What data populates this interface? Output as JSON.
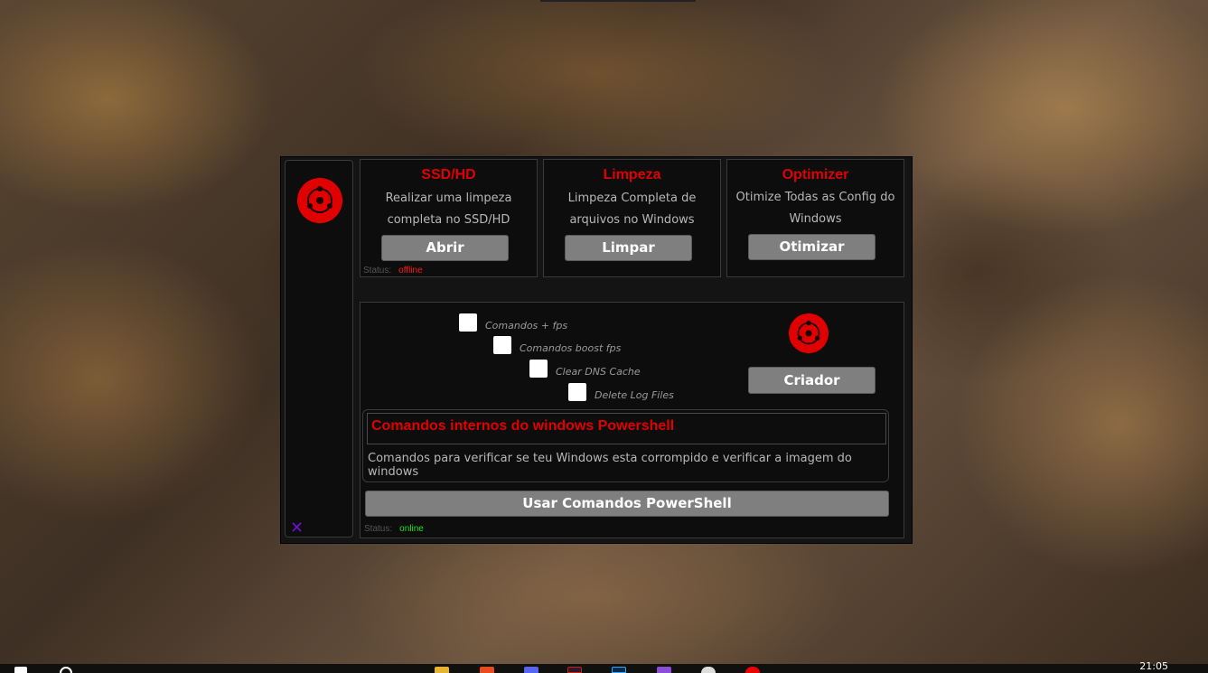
{
  "app": {
    "cards": [
      {
        "title": "SSD/HD",
        "description": "Realizar uma limpeza completa no SSD/HD",
        "button": "Abrir"
      },
      {
        "title": "Limpeza",
        "description": "Limpeza Completa de arquivos no Windows",
        "button": "Limpar"
      },
      {
        "title": "Optimizer",
        "description": "Otimize Todas as Config do Windows",
        "button": "Otimizar"
      }
    ],
    "status_top": {
      "label": "Status:",
      "value": "offline",
      "value_color": "#ff1a1a"
    },
    "options": [
      {
        "label": "Comandos + fps",
        "checked": false
      },
      {
        "label": "Comandos boost fps",
        "checked": false
      },
      {
        "label": "Clear DNS Cache",
        "checked": false
      },
      {
        "label": "Delete Log Files",
        "checked": false
      }
    ],
    "creator_button": "Criador",
    "powershell": {
      "title": "Comandos internos do windows Powershell",
      "description": "Comandos para verificar se teu Windows esta corrompido e verificar a imagem do windows",
      "button": "Usar Comandos PowerShell"
    },
    "status_bottom": {
      "label": "Status:",
      "value": "online",
      "value_color": "#22e022"
    },
    "close_glyph": "✕",
    "logo_icon": "sharingan-icon",
    "accent_color": "#e00000"
  },
  "taskbar": {
    "clock": "21:05",
    "icons": [
      "start-icon",
      "search-icon",
      "file-explorer-icon",
      "app-icon",
      "discord-icon",
      "app-icon",
      "photoshop-icon",
      "visual-studio-icon",
      "steam-icon",
      "app-icon"
    ]
  }
}
